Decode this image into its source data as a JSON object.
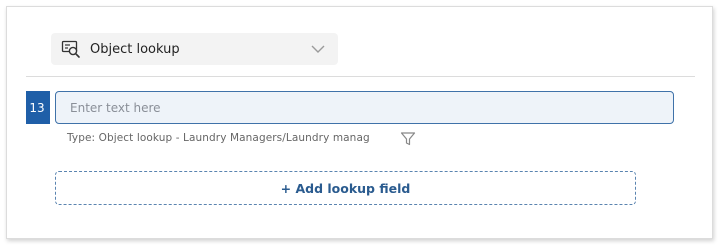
{
  "type_selector": {
    "icon": "object-lookup-icon",
    "label": "Object lookup",
    "chevron_icon": "chevron-down-icon"
  },
  "field": {
    "row_number": "13",
    "value": "",
    "placeholder": "Enter text here"
  },
  "type_hint": {
    "text": "Type: Object lookup - Laundry Managers/Laundry manag",
    "filter_icon": "filter-icon"
  },
  "add_button": {
    "label": "+ Add lookup field"
  },
  "colors": {
    "accent": "#1f5fa8",
    "input_background": "#eef3f9",
    "input_border": "#3f72a9",
    "link_text": "#2a5b8f"
  }
}
